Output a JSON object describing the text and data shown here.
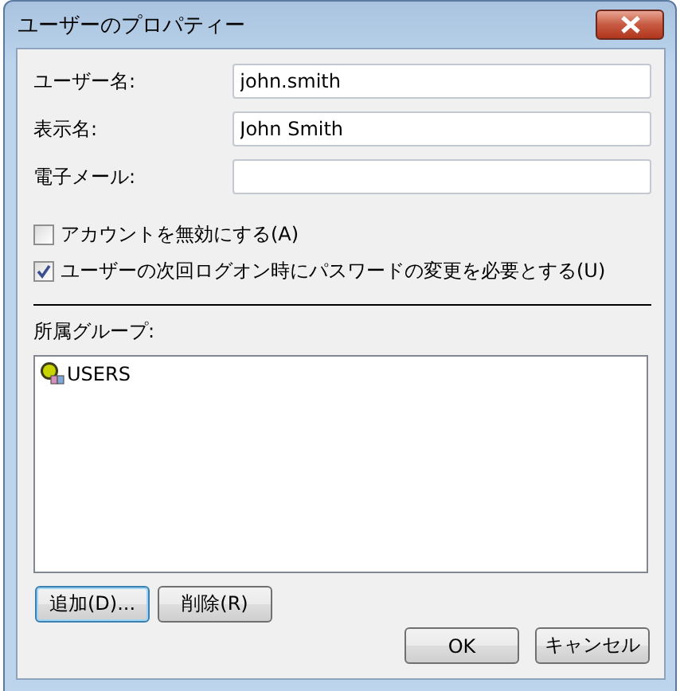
{
  "window": {
    "title": "ユーザーのプロパティー"
  },
  "fields": [
    {
      "label": "ユーザー名:",
      "value": "john.smith"
    },
    {
      "label": "表示名:",
      "value": "John Smith"
    },
    {
      "label": "電子メール:"
    }
  ],
  "options": [
    {
      "label": "アカウントを無効にする(A)",
      "checked": false
    },
    {
      "label": "ユーザーの次回ログオン時にパスワードの変更を必要とする(U)",
      "checked": true
    }
  ],
  "groups": {
    "label": "所属グループ:",
    "items": [
      {
        "name": "USERS"
      }
    ]
  },
  "group_buttons": [
    {
      "label": "追加(D)...",
      "focused": true
    },
    {
      "label": "削除(R)",
      "focused": false
    }
  ],
  "buttons": [
    {
      "label": "OK",
      "focused": false
    },
    {
      "label": "キャンセル",
      "focused": false
    }
  ]
}
